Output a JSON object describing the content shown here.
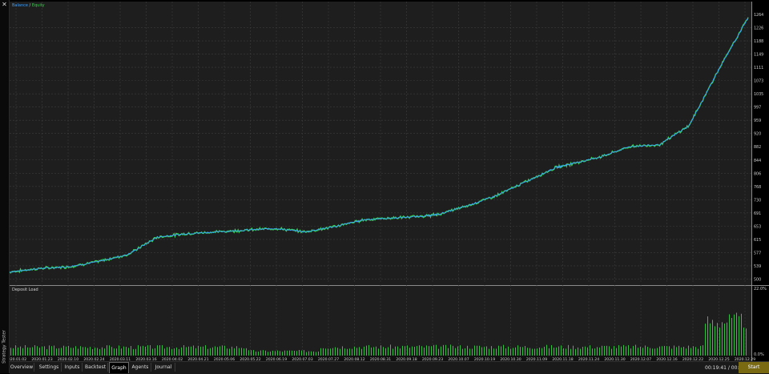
{
  "panel": {
    "title": "Strategy Tester",
    "close_glyph": "✕",
    "close_icon": "close-icon"
  },
  "tabs": [
    {
      "label": "Overview",
      "active": false
    },
    {
      "label": "Settings",
      "active": false
    },
    {
      "label": "Inputs",
      "active": false
    },
    {
      "label": "Backtest",
      "active": false
    },
    {
      "label": "Graph",
      "active": true
    },
    {
      "label": "Agents",
      "active": false
    },
    {
      "label": "Journal",
      "active": false
    }
  ],
  "status": {
    "time": "00:19:41 / 00:19:42",
    "start_label": "Start"
  },
  "colors": {
    "background": "#1e1e1e",
    "grid": "#3c3c3c",
    "balance": "#3aa0ff",
    "equity": "#35d04a",
    "load_bar": "#2fc23f",
    "start_button": "#7a6a12"
  },
  "chart_data": [
    {
      "type": "line",
      "legend": {
        "balance": "Balance",
        "separator": " / ",
        "equity": "Equity"
      },
      "legend_position": "top-left",
      "grid": true,
      "ylim": [
        467,
        1264
      ],
      "y_ticks": [
        "1264",
        "1226",
        "1188",
        "1149",
        "1111",
        "1073",
        "1035",
        "997",
        "959",
        "920",
        "882",
        "844",
        "806",
        "768",
        "730",
        "691",
        "653",
        "615",
        "577",
        "539",
        "500",
        "467"
      ],
      "series": [
        {
          "name": "Balance",
          "x_index": [
            0,
            4,
            8,
            12,
            16,
            20,
            24,
            28,
            32,
            36,
            40,
            44,
            48,
            52,
            56,
            58,
            62,
            66,
            70,
            74,
            76,
            80,
            84,
            88,
            92,
            96,
            100
          ],
          "values": [
            500,
            510,
            515,
            530,
            550,
            600,
            610,
            615,
            620,
            625,
            615,
            630,
            650,
            655,
            660,
            665,
            690,
            720,
            760,
            800,
            810,
            830,
            860,
            865,
            920,
            1080,
            1230
          ]
        }
      ],
      "x_ticks": [
        "2020.01.02",
        "2020.01.23",
        "2020.02.10",
        "2020.02.24",
        "2020.03.11",
        "2020.03.16",
        "2020.04.02",
        "2020.04.21",
        "2020.05.06",
        "2020.05.22",
        "2020.06.19",
        "2020.07.03",
        "2020.07.27",
        "2020.08.12",
        "2020.08.31",
        "2020.09.18",
        "2020.09.23",
        "2020.10.07",
        "2020.10.19",
        "2020.10.30",
        "2020.11.09",
        "2020.11.18",
        "2020.11.24",
        "2020.11.30",
        "2020.12.07",
        "2020.12.16",
        "2020.12.22",
        "2020.12.25",
        "2020.12.29"
      ]
    },
    {
      "type": "bar",
      "title": "Deposit Load",
      "ylim": [
        0,
        22
      ],
      "y_ticks": [
        "22.0%",
        "0.0%"
      ],
      "segments": [
        {
          "from": 0,
          "to": 0.32,
          "value": 2.8
        },
        {
          "from": 0.32,
          "to": 0.42,
          "value": 1.5
        },
        {
          "from": 0.42,
          "to": 0.94,
          "value": 2.9
        },
        {
          "from": 0.94,
          "to": 1.0,
          "value": 11.5
        }
      ]
    }
  ]
}
